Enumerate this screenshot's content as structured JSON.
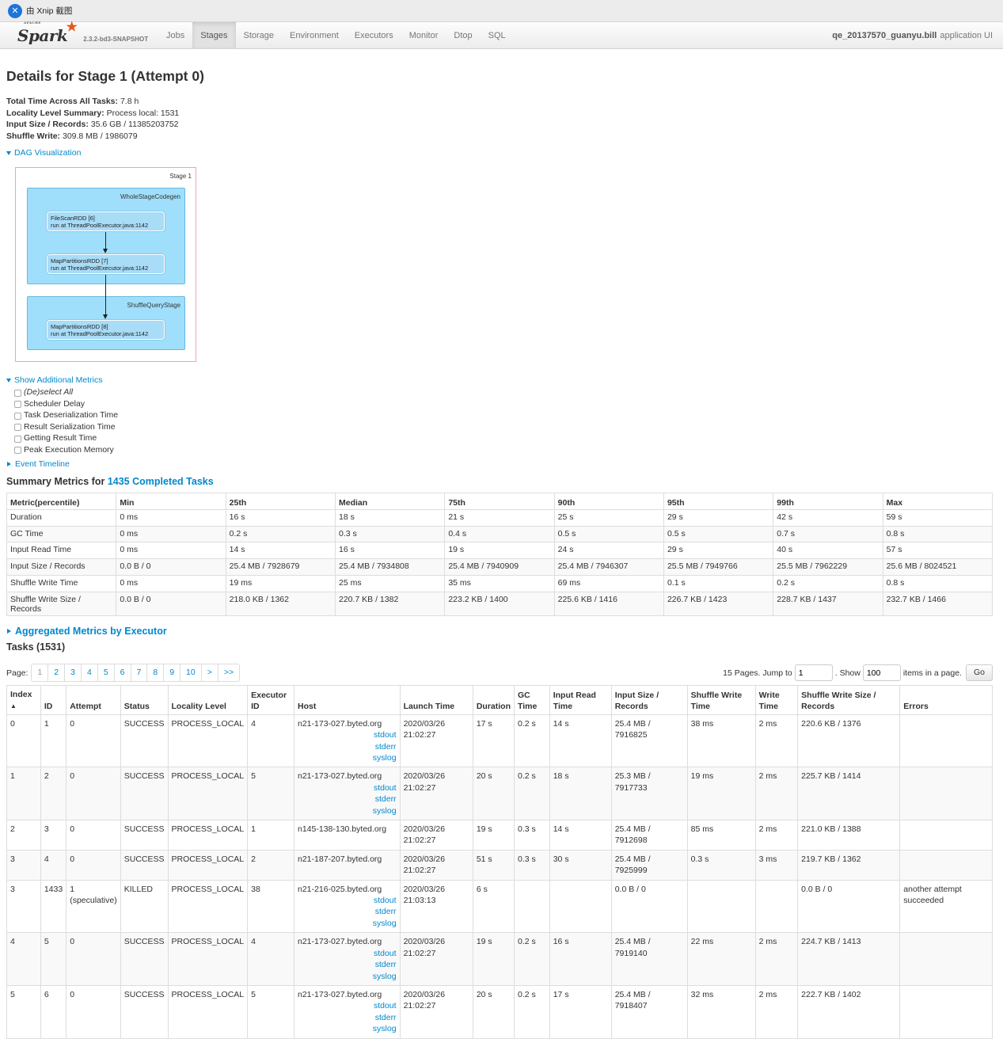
{
  "capture_bar": {
    "label": "由 Xnip 截图"
  },
  "navbar": {
    "logo_small": "APACHE",
    "logo": "Spark",
    "version": "2.3.2-bd3-SNAPSHOT",
    "tabs": [
      "Jobs",
      "Stages",
      "Storage",
      "Environment",
      "Executors",
      "Monitor",
      "Dtop",
      "SQL"
    ],
    "active_tab": "Stages",
    "app_name": "qe_20137570_guanyu.bill",
    "app_suffix": "application UI"
  },
  "page": {
    "title": "Details for Stage 1 (Attempt 0)",
    "summary": [
      {
        "label": "Total Time Across All Tasks:",
        "value": "7.8 h"
      },
      {
        "label": "Locality Level Summary:",
        "value": "Process local: 1531"
      },
      {
        "label": "Input Size / Records:",
        "value": "35.6 GB / 11385203752"
      },
      {
        "label": "Shuffle Write:",
        "value": "309.8 MB / 1986079"
      }
    ]
  },
  "dag": {
    "toggle": "DAG Visualization",
    "stage": "Stage 1",
    "clusters": [
      "WholeStageCodegen",
      "ShuffleQueryStage"
    ],
    "nodes": [
      {
        "name": "FileScanRDD [6]",
        "site": "run at ThreadPoolExecutor.java:1142"
      },
      {
        "name": "MapPartitionsRDD [7]",
        "site": "run at ThreadPoolExecutor.java:1142"
      },
      {
        "name": "MapPartitionsRDD [8]",
        "site": "run at ThreadPoolExecutor.java:1142"
      }
    ]
  },
  "additional_metrics": {
    "toggle": "Show Additional Metrics",
    "options": [
      "(De)select All",
      "Scheduler Delay",
      "Task Deserialization Time",
      "Result Serialization Time",
      "Getting Result Time",
      "Peak Execution Memory"
    ]
  },
  "event_timeline": {
    "toggle": "Event Timeline"
  },
  "summary_metrics": {
    "heading_prefix": "Summary Metrics for ",
    "heading_link": "1435 Completed Tasks",
    "columns": [
      "Metric(percentile)",
      "Min",
      "25th",
      "Median",
      "75th",
      "90th",
      "95th",
      "99th",
      "Max"
    ],
    "rows": [
      [
        "Duration",
        "0 ms",
        "16 s",
        "18 s",
        "21 s",
        "25 s",
        "29 s",
        "42 s",
        "59 s"
      ],
      [
        "GC Time",
        "0 ms",
        "0.2 s",
        "0.3 s",
        "0.4 s",
        "0.5 s",
        "0.5 s",
        "0.7 s",
        "0.8 s"
      ],
      [
        "Input Read Time",
        "0 ms",
        "14 s",
        "16 s",
        "19 s",
        "24 s",
        "29 s",
        "40 s",
        "57 s"
      ],
      [
        "Input Size / Records",
        "0.0 B / 0",
        "25.4 MB / 7928679",
        "25.4 MB / 7934808",
        "25.4 MB / 7940909",
        "25.4 MB / 7946307",
        "25.5 MB / 7949766",
        "25.5 MB / 7962229",
        "25.6 MB / 8024521"
      ],
      [
        "Shuffle Write Time",
        "0 ms",
        "19 ms",
        "25 ms",
        "35 ms",
        "69 ms",
        "0.1 s",
        "0.2 s",
        "0.8 s"
      ],
      [
        "Shuffle Write Size / Records",
        "0.0 B / 0",
        "218.0 KB / 1362",
        "220.7 KB / 1382",
        "223.2 KB / 1400",
        "225.6 KB / 1416",
        "226.7 KB / 1423",
        "228.7 KB / 1437",
        "232.7 KB / 1466"
      ]
    ]
  },
  "aggregated": {
    "toggle": "Aggregated Metrics by Executor"
  },
  "tasks": {
    "heading": "Tasks (1531)",
    "pager": {
      "label": "Page:",
      "pages": [
        "1",
        "2",
        "3",
        "4",
        "5",
        "6",
        "7",
        "8",
        "9",
        "10",
        ">",
        ">>"
      ],
      "pages_text": "15 Pages. Jump to",
      "jump_value": "1",
      "show_text": ". Show",
      "show_value": "100",
      "items_text": "items in a page.",
      "go": "Go"
    },
    "columns": [
      "Index",
      "ID",
      "Attempt",
      "Status",
      "Locality Level",
      "Executor ID",
      "Host",
      "Launch Time",
      "Duration",
      "GC Time",
      "Input Read Time",
      "Input Size / Records",
      "Shuffle Write Time",
      "Write Time",
      "Shuffle Write Size / Records",
      "Errors"
    ],
    "sort_indicator": "▲",
    "log_links": [
      "stdout",
      "stderr",
      "syslog"
    ],
    "rows": [
      {
        "index": "0",
        "id": "1",
        "attempt": "0",
        "status": "SUCCESS",
        "locality": "PROCESS_LOCAL",
        "executor": "4",
        "host": "n21-173-027.byted.org",
        "logs": true,
        "launch_date": "2020/03/26",
        "launch_time": "21:02:27",
        "duration": "17 s",
        "gc": "0.2 s",
        "input_read": "14 s",
        "input_size": "25.4 MB / 7916825",
        "shuffle_write_time": "38 ms",
        "write_time": "2 ms",
        "shuffle_write_size": "220.6 KB / 1376",
        "errors": ""
      },
      {
        "index": "1",
        "id": "2",
        "attempt": "0",
        "status": "SUCCESS",
        "locality": "PROCESS_LOCAL",
        "executor": "5",
        "host": "n21-173-027.byted.org",
        "logs": true,
        "launch_date": "2020/03/26",
        "launch_time": "21:02:27",
        "duration": "20 s",
        "gc": "0.2 s",
        "input_read": "18 s",
        "input_size": "25.3 MB / 7917733",
        "shuffle_write_time": "19 ms",
        "write_time": "2 ms",
        "shuffle_write_size": "225.7 KB / 1414",
        "errors": ""
      },
      {
        "index": "2",
        "id": "3",
        "attempt": "0",
        "status": "SUCCESS",
        "locality": "PROCESS_LOCAL",
        "executor": "1",
        "host": "n145-138-130.byted.org",
        "logs": false,
        "launch_date": "2020/03/26",
        "launch_time": "21:02:27",
        "duration": "19 s",
        "gc": "0.3 s",
        "input_read": "14 s",
        "input_size": "25.4 MB / 7912698",
        "shuffle_write_time": "85 ms",
        "write_time": "2 ms",
        "shuffle_write_size": "221.0 KB / 1388",
        "errors": ""
      },
      {
        "index": "3",
        "id": "4",
        "attempt": "0",
        "status": "SUCCESS",
        "locality": "PROCESS_LOCAL",
        "executor": "2",
        "host": "n21-187-207.byted.org",
        "logs": false,
        "launch_date": "2020/03/26",
        "launch_time": "21:02:27",
        "duration": "51 s",
        "gc": "0.3 s",
        "input_read": "30 s",
        "input_size": "25.4 MB / 7925999",
        "shuffle_write_time": "0.3 s",
        "write_time": "3 ms",
        "shuffle_write_size": "219.7 KB / 1362",
        "errors": ""
      },
      {
        "index": "3",
        "id": "1433",
        "attempt": "1",
        "attempt_note": "(speculative)",
        "status": "KILLED",
        "locality": "PROCESS_LOCAL",
        "executor": "38",
        "host": "n21-216-025.byted.org",
        "logs": true,
        "launch_date": "2020/03/26",
        "launch_time": "21:03:13",
        "duration": "6 s",
        "gc": "",
        "input_read": "",
        "input_size": "0.0 B / 0",
        "shuffle_write_time": "",
        "write_time": "",
        "shuffle_write_size": "0.0 B / 0",
        "errors": "another attempt succeeded"
      },
      {
        "index": "4",
        "id": "5",
        "attempt": "0",
        "status": "SUCCESS",
        "locality": "PROCESS_LOCAL",
        "executor": "4",
        "host": "n21-173-027.byted.org",
        "logs": true,
        "launch_date": "2020/03/26",
        "launch_time": "21:02:27",
        "duration": "19 s",
        "gc": "0.2 s",
        "input_read": "16 s",
        "input_size": "25.4 MB / 7919140",
        "shuffle_write_time": "22 ms",
        "write_time": "2 ms",
        "shuffle_write_size": "224.7 KB / 1413",
        "errors": ""
      },
      {
        "index": "5",
        "id": "6",
        "attempt": "0",
        "status": "SUCCESS",
        "locality": "PROCESS_LOCAL",
        "executor": "5",
        "host": "n21-173-027.byted.org",
        "logs": true,
        "launch_date": "2020/03/26",
        "launch_time": "21:02:27",
        "duration": "20 s",
        "gc": "0.2 s",
        "input_read": "17 s",
        "input_size": "25.4 MB / 7918407",
        "shuffle_write_time": "32 ms",
        "write_time": "2 ms",
        "shuffle_write_size": "222.7 KB / 1402",
        "errors": ""
      }
    ]
  },
  "colors": {
    "link": "#0088cc",
    "spark_star": "#e25a1c",
    "dag_cluster": "#a0dffb",
    "dag_border": "#f1a2b2"
  },
  "icons": {
    "capture_app": "xnip-icon",
    "expanded": "caret-down-icon",
    "collapsed": "caret-right-icon",
    "spark_star": "star-icon"
  }
}
